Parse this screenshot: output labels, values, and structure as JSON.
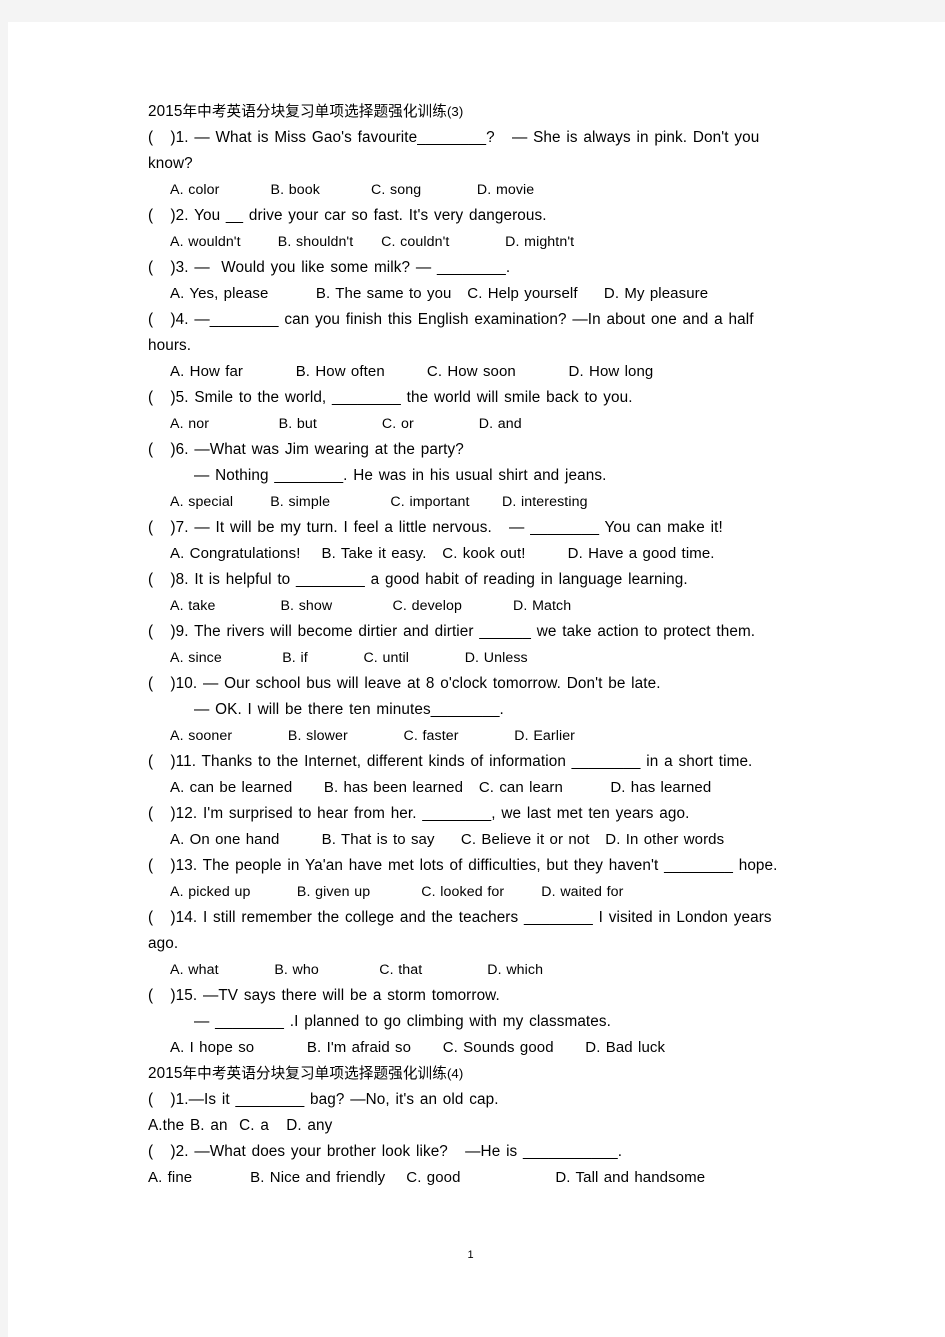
{
  "page": {
    "background_color": "#f4f4f4",
    "paper_color": "#ffffff",
    "text_color": "#000000",
    "page_number": "1"
  },
  "sections": [
    {
      "heading": {
        "year": "2015",
        "cjk": "年中考英语分块复习单项选择题强化训练",
        "suffix": "(3)"
      },
      "lines": [
        {
          "id": "q1a",
          "indent": 1,
          "style": "q",
          "text": "(   )1. — What is Miss Gao's favourite________?   — She is always in pink. Don't you"
        },
        {
          "id": "q1b",
          "indent": 0,
          "style": "q",
          "text": "know?"
        },
        {
          "id": "q1o",
          "indent": 2,
          "style": "opt",
          "text": "A. color           B. book           C. song            D. movie"
        },
        {
          "id": "q2a",
          "indent": 1,
          "style": "q",
          "text": "(   )2. You __ drive your car so fast. It's very dangerous."
        },
        {
          "id": "q2o",
          "indent": 2,
          "style": "opt",
          "text": "A. wouldn't        B. shouldn't      C. couldn't            D. mightn't"
        },
        {
          "id": "q3a",
          "indent": 1,
          "style": "q",
          "text": "(   )3. —  Would you like some milk? — ________."
        },
        {
          "id": "q3o",
          "indent": 2,
          "style": "opt-lg",
          "text": "A. Yes, please         B. The same to you   C. Help yourself     D. My pleasure"
        },
        {
          "id": "q4a",
          "indent": 1,
          "style": "q",
          "text": "(   )4. —________ can you finish this English examination? —In about one and a half"
        },
        {
          "id": "q4b",
          "indent": 0,
          "style": "q",
          "text": "hours."
        },
        {
          "id": "q4o",
          "indent": 2,
          "style": "opt-lg",
          "text": "A. How far          B. How often        C. How soon          D. How long"
        },
        {
          "id": "q5a",
          "indent": 1,
          "style": "q",
          "text": "(   )5. Smile to the world, ________ the world will smile back to you."
        },
        {
          "id": "q5o",
          "indent": 2,
          "style": "opt",
          "text": "A. nor               B. but              C. or              D. and"
        },
        {
          "id": "q6a",
          "indent": 1,
          "style": "q",
          "text": "(   )6. —What was Jim wearing at the party?"
        },
        {
          "id": "q6b",
          "indent": 3,
          "style": "q",
          "text": "— Nothing ________. He was in his usual shirt and jeans."
        },
        {
          "id": "q6o",
          "indent": 2,
          "style": "opt",
          "text": "A. special        B. simple             C. important       D. interesting"
        },
        {
          "id": "q7a",
          "indent": 1,
          "style": "q",
          "text": "(   )7. — It will be my turn. I feel a little nervous.   — ________ You can make it!"
        },
        {
          "id": "q7o",
          "indent": 2,
          "style": "opt-lg",
          "text": "A. Congratulations!    B. Take it easy.   C. kook out!        D. Have a good time."
        },
        {
          "id": "q8a",
          "indent": 1,
          "style": "q",
          "text": "(   )8. It is helpful to ________ a good habit of reading in language learning."
        },
        {
          "id": "q8o",
          "indent": 2,
          "style": "opt",
          "text": "A. take              B. show             C. develop           D. Match"
        },
        {
          "id": "q9a",
          "indent": 1,
          "style": "q",
          "text": "(   )9. The rivers will become dirtier and dirtier ______ we take action to protect them."
        },
        {
          "id": "q9o",
          "indent": 2,
          "style": "opt",
          "text": "A. since             B. if            C. until            D. Unless"
        },
        {
          "id": "q10a",
          "indent": 1,
          "style": "q",
          "text": "(   )10. — Our school bus will leave at 8 o'clock tomorrow. Don't be late."
        },
        {
          "id": "q10b",
          "indent": 3,
          "style": "q",
          "text": "— OK. I will be there ten minutes________."
        },
        {
          "id": "q10o",
          "indent": 2,
          "style": "opt",
          "text": "A. sooner            B. slower            C. faster            D. Earlier"
        },
        {
          "id": "q11a",
          "indent": 1,
          "style": "q",
          "text": "(   )11. Thanks to the Internet, different kinds of information ________ in a short time."
        },
        {
          "id": "q11o",
          "indent": 2,
          "style": "opt-lg",
          "text": "A. can be learned      B. has been learned   C. can learn         D. has learned"
        },
        {
          "id": "q12a",
          "indent": 1,
          "style": "q",
          "text": "(   )12. I'm surprised to hear from her. ________, we last met ten years ago."
        },
        {
          "id": "q12o",
          "indent": 2,
          "style": "opt-lg",
          "text": "A. On one hand        B. That is to say     C. Believe it or not   D. In other words"
        },
        {
          "id": "q13a",
          "indent": 1,
          "style": "q",
          "text": "(   )13. The people in Ya'an have met lots of difficulties, but they haven't ________ hope."
        },
        {
          "id": "q13o",
          "indent": 2,
          "style": "opt",
          "text": "A. picked up          B. given up           C. looked for        D. waited for"
        },
        {
          "id": "q14a",
          "indent": 1,
          "style": "q",
          "text": "(   )14. I still remember the college and the teachers ________ I visited in London years"
        },
        {
          "id": "q14b",
          "indent": 0,
          "style": "q",
          "text": "ago."
        },
        {
          "id": "q14o",
          "indent": 2,
          "style": "opt",
          "text": "A. what            B. who             C. that              D. which"
        },
        {
          "id": "q15a",
          "indent": 1,
          "style": "q",
          "text": "(   )15. —TV says there will be a storm tomorrow."
        },
        {
          "id": "q15b",
          "indent": 3,
          "style": "q",
          "text": "— ________ .I planned to go climbing with my classmates."
        },
        {
          "id": "q15o",
          "indent": 2,
          "style": "opt-lg",
          "text": "A. I hope so          B. I'm afraid so      C. Sounds good      D. Bad luck"
        }
      ]
    },
    {
      "heading": {
        "year": "2015",
        "cjk": "年中考英语分块复习单项选择题强化训练",
        "suffix": "(4)"
      },
      "lines": [
        {
          "id": "s2q1a",
          "indent": 1,
          "style": "q",
          "text": "(   )1.—Is it ________ bag? —No, it's an old cap."
        },
        {
          "id": "s2q1o",
          "indent": 0,
          "style": "q",
          "text": "A.the B. an  C. a   D. any"
        },
        {
          "id": "s2q2a",
          "indent": 1,
          "style": "q",
          "text": "(   )2. —What does your brother look like?   —He is ___________."
        },
        {
          "id": "s2q2o",
          "indent": 0,
          "style": "opt-lg",
          "text": "A. fine           B. Nice and friendly    C. good                  D. Tall and handsome"
        }
      ]
    }
  ]
}
